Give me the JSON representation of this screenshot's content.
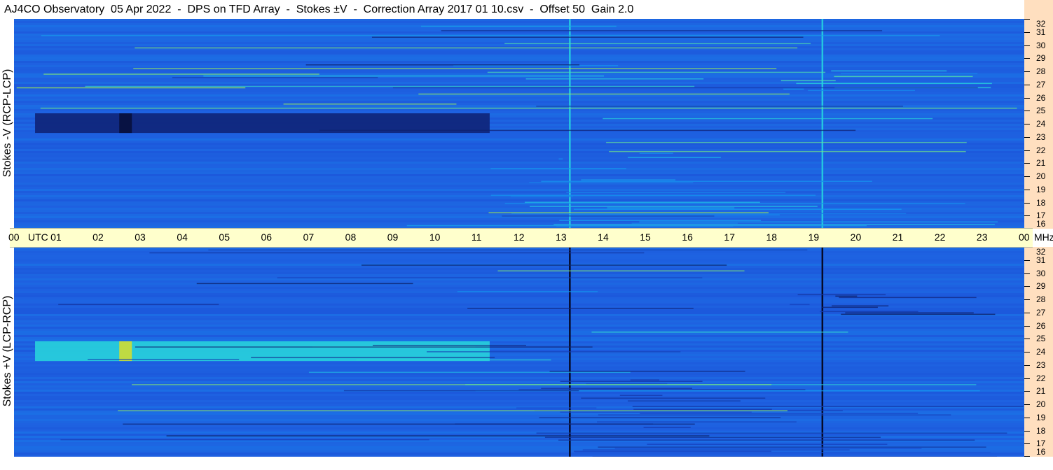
{
  "title": "AJ4CO Observatory  05 Apr 2022  -  DPS on TFD Array  -  Stokes ±V  -  Correction Array 2017 01 10.csv  -  Offset 50  Gain 2.0",
  "panels": {
    "top_ylabel": "Stokes -V (RCP-LCP)",
    "bottom_ylabel": "Stokes +V (LCP-RCP)"
  },
  "time_axis": {
    "labels": [
      "00",
      "UTC",
      "01",
      "02",
      "03",
      "04",
      "05",
      "06",
      "07",
      "08",
      "09",
      "10",
      "11",
      "12",
      "13",
      "14",
      "15",
      "16",
      "17",
      "18",
      "19",
      "20",
      "21",
      "22",
      "23",
      "00",
      "MHz"
    ]
  },
  "freq_axis": {
    "top_labels": [
      "32",
      "31",
      "30",
      "29",
      "28",
      "27",
      "26",
      "25",
      "24",
      "23",
      "22",
      "21",
      "20",
      "19",
      "18",
      "17",
      "16"
    ],
    "bottom_labels": [
      "32",
      "31",
      "30",
      "29",
      "28",
      "27",
      "26",
      "25",
      "24",
      "23",
      "22",
      "21",
      "20",
      "19",
      "18",
      "17",
      "16"
    ]
  },
  "colors": {
    "background_blue": "#1e62e0",
    "dark_band_top": "#0a1a4a",
    "bright_band_bottom": "#b8f040",
    "timebar": "#ffffcc",
    "freq_column": "#ffdfbf"
  },
  "chart_data": [
    {
      "type": "heatmap",
      "name": "Stokes -V (RCP-LCP)",
      "x_range_utc_hours": [
        0,
        24
      ],
      "y_range_mhz": [
        16,
        32
      ],
      "features": [
        {
          "kind": "band",
          "freq_mhz": [
            23.3,
            24.8
          ],
          "time_utc": [
            0.5,
            11.3
          ],
          "level": -0.6
        },
        {
          "kind": "band",
          "freq_mhz": [
            23.3,
            24.8
          ],
          "time_utc": [
            2.5,
            2.8
          ],
          "level": -0.9
        },
        {
          "kind": "vline",
          "time_utc": 13.2,
          "level": 0.5
        },
        {
          "kind": "vline",
          "time_utc": 19.2,
          "level": 0.5
        },
        {
          "kind": "noise",
          "freq_mhz": [
            16,
            22
          ],
          "time_utc": [
            11.3,
            24
          ],
          "level": 0.35
        },
        {
          "kind": "noise",
          "freq_mhz": [
            26.5,
            28.5
          ],
          "time_utc": [
            18,
            24
          ],
          "level": 0.5
        }
      ]
    },
    {
      "type": "heatmap",
      "name": "Stokes +V (LCP-RCP)",
      "x_range_utc_hours": [
        0,
        24
      ],
      "y_range_mhz": [
        16,
        32
      ],
      "features": [
        {
          "kind": "band",
          "freq_mhz": [
            23.3,
            24.8
          ],
          "time_utc": [
            0.5,
            11.3
          ],
          "level": 0.55
        },
        {
          "kind": "band",
          "freq_mhz": [
            23.3,
            24.8
          ],
          "time_utc": [
            2.5,
            2.8
          ],
          "level": 0.9
        },
        {
          "kind": "vline",
          "time_utc": 13.2,
          "level": -1.0
        },
        {
          "kind": "vline",
          "time_utc": 19.2,
          "level": -1.0
        },
        {
          "kind": "noise",
          "freq_mhz": [
            16,
            22
          ],
          "time_utc": [
            11.3,
            24
          ],
          "level": -0.35
        },
        {
          "kind": "noise",
          "freq_mhz": [
            26.5,
            28.5
          ],
          "time_utc": [
            18,
            24
          ],
          "level": -0.6
        }
      ]
    }
  ]
}
